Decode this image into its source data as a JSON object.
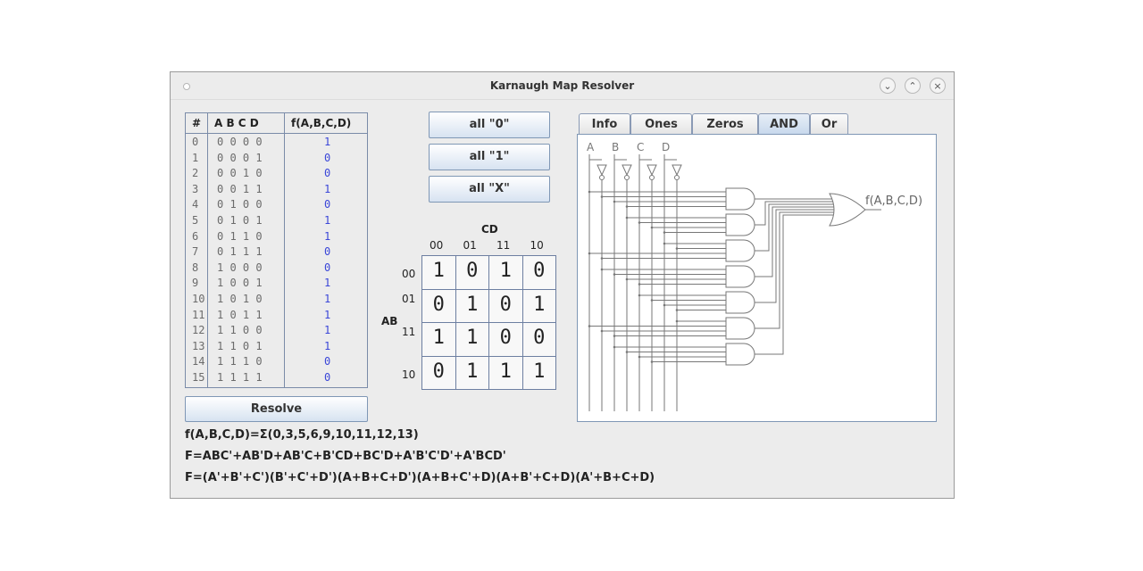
{
  "window": {
    "title": "Karnaugh Map Resolver"
  },
  "truth_table": {
    "headers": {
      "index": "#",
      "vars": "A B C D",
      "func": "f(A,B,C,D)"
    },
    "rows": [
      {
        "i": "0",
        "bits": "0 0 0 0",
        "f": "1"
      },
      {
        "i": "1",
        "bits": "0 0 0 1",
        "f": "0"
      },
      {
        "i": "2",
        "bits": "0 0 1 0",
        "f": "0"
      },
      {
        "i": "3",
        "bits": "0 0 1 1",
        "f": "1"
      },
      {
        "i": "4",
        "bits": "0 1 0 0",
        "f": "0"
      },
      {
        "i": "5",
        "bits": "0 1 0 1",
        "f": "1"
      },
      {
        "i": "6",
        "bits": "0 1 1 0",
        "f": "1"
      },
      {
        "i": "7",
        "bits": "0 1 1 1",
        "f": "0"
      },
      {
        "i": "8",
        "bits": "1 0 0 0",
        "f": "0"
      },
      {
        "i": "9",
        "bits": "1 0 0 1",
        "f": "1"
      },
      {
        "i": "10",
        "bits": "1 0 1 0",
        "f": "1"
      },
      {
        "i": "11",
        "bits": "1 0 1 1",
        "f": "1"
      },
      {
        "i": "12",
        "bits": "1 1 0 0",
        "f": "1"
      },
      {
        "i": "13",
        "bits": "1 1 0 1",
        "f": "1"
      },
      {
        "i": "14",
        "bits": "1 1 1 0",
        "f": "0"
      },
      {
        "i": "15",
        "bits": "1 1 1 1",
        "f": "0"
      }
    ]
  },
  "buttons": {
    "all0": "all \"0\"",
    "all1": "all \"1\"",
    "allX": "all \"X\"",
    "resolve": "Resolve"
  },
  "kmap": {
    "col_var": "CD",
    "row_var": "AB",
    "col_labels": [
      "00",
      "01",
      "11",
      "10"
    ],
    "row_labels": [
      "00",
      "01",
      "11",
      "10"
    ],
    "cells": [
      [
        "1",
        "0",
        "1",
        "0"
      ],
      [
        "0",
        "1",
        "0",
        "1"
      ],
      [
        "1",
        "1",
        "0",
        "0"
      ],
      [
        "0",
        "1",
        "1",
        "1"
      ]
    ]
  },
  "tabs": [
    "Info",
    "Ones",
    "Zeros",
    "AND",
    "Or"
  ],
  "active_tab": "AND",
  "circuit": {
    "inputs": [
      "A",
      "B",
      "C",
      "D"
    ],
    "output_label": "f(A,B,C,D)"
  },
  "formulas": {
    "sum": "f(A,B,C,D)=Σ(0,3,5,6,9,10,11,12,13)",
    "sop": "F=ABC'+AB'D+AB'C+B'CD+BC'D+A'B'C'D'+A'BCD'",
    "pos": "F=(A'+B'+C')(B'+C'+D')(A+B+C+D')(A+B+C'+D)(A+B'+C+D)(A'+B+C+D)"
  },
  "colors": {
    "accent": "#3a46d8",
    "border": "#7a8ba8"
  }
}
